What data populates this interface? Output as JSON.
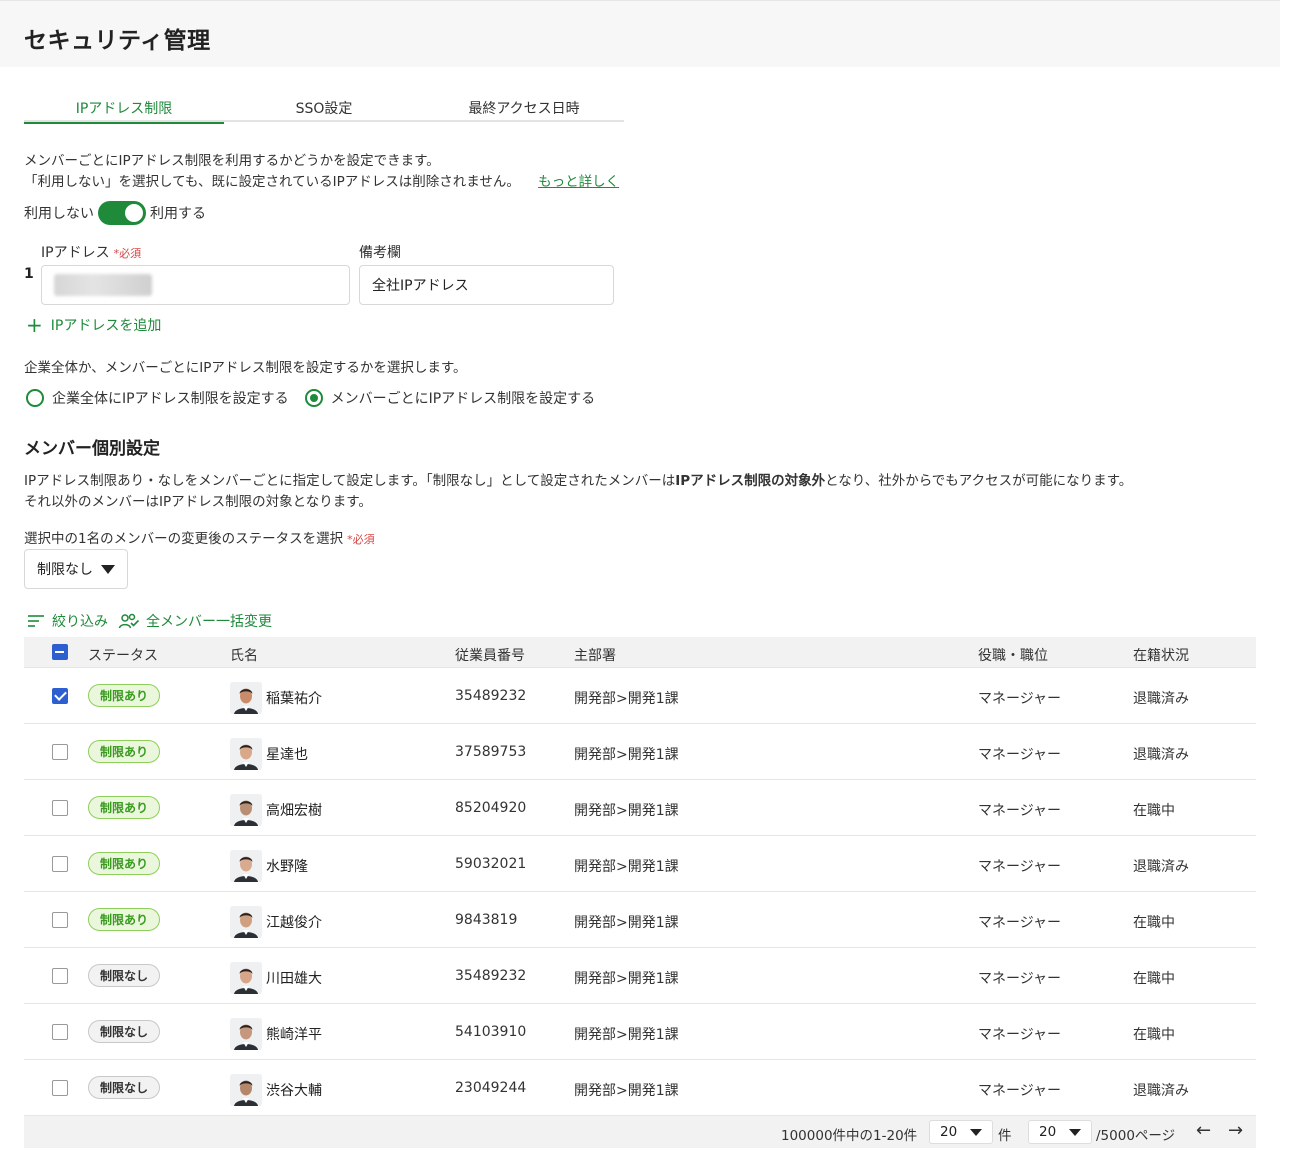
{
  "header": {
    "title": "セキュリティ管理"
  },
  "tabs": [
    {
      "label": "IPアドレス制限",
      "active": true
    },
    {
      "label": "SSO設定",
      "active": false
    },
    {
      "label": "最終アクセス日時",
      "active": false
    }
  ],
  "intro": {
    "line1": "メンバーごとにIPアドレス制限を利用するかどうかを設定できます。",
    "line2": "「利用しない」を選択しても、既に設定されているIPアドレスは削除されません。",
    "more_link": "もっと詳しく"
  },
  "toggle": {
    "off_label": "利用しない",
    "on_label": "利用する",
    "enabled": true
  },
  "ip_form": {
    "ip_label": "IPアドレス",
    "required_mark": "*必須",
    "note_label": "備考欄",
    "row_number": "1",
    "note_value": "全社IPアドレス",
    "add_label": "IPアドレスを追加"
  },
  "scope": {
    "description": "企業全体か、メンバーごとにIPアドレス制限を設定するかを選択します。",
    "options": [
      {
        "label": "企業全体にIPアドレス制限を設定する",
        "checked": false
      },
      {
        "label": "メンバーごとにIPアドレス制限を設定する",
        "checked": true
      }
    ]
  },
  "member_settings": {
    "title": "メンバー個別設定",
    "desc_part1": "IPアドレス制限あり・なしをメンバーごとに指定して設定します。「制限なし」として設定されたメンバーは",
    "desc_bold": "IPアドレス制限の対象外",
    "desc_part2": "となり、社外からでもアクセスが可能になります。",
    "desc_line2": "それ以外のメンバーはIPアドレス制限の対象となります。",
    "status_prompt": "選択中の1名のメンバーの変更後のステータスを選択",
    "required_mark": "*必須",
    "status_select": "制限なし",
    "filter_label": "絞り込み",
    "bulk_label": "全メンバー一括変更"
  },
  "table": {
    "columns": [
      "ステータス",
      "氏名",
      "従業員番号",
      "主部署",
      "役職・職位",
      "在籍状況"
    ],
    "rows": [
      {
        "checked": true,
        "status": "制限あり",
        "status_on": true,
        "name": "稲葉祐介",
        "emp_no": "35489232",
        "dept": "開発部>開発1課",
        "role": "マネージャー",
        "employment": "退職済み",
        "avatar": "#c98c6a"
      },
      {
        "checked": false,
        "status": "制限あり",
        "status_on": true,
        "name": "星達也",
        "emp_no": "37589753",
        "dept": "開発部>開発1課",
        "role": "マネージャー",
        "employment": "退職済み",
        "avatar": "#d9a888"
      },
      {
        "checked": false,
        "status": "制限あり",
        "status_on": true,
        "name": "高畑宏樹",
        "emp_no": "85204920",
        "dept": "開発部>開発1課",
        "role": "マネージャー",
        "employment": "在職中",
        "avatar": "#b98f74"
      },
      {
        "checked": false,
        "status": "制限あり",
        "status_on": true,
        "name": "水野隆",
        "emp_no": "59032021",
        "dept": "開発部>開発1課",
        "role": "マネージャー",
        "employment": "退職済み",
        "avatar": "#d8ab90"
      },
      {
        "checked": false,
        "status": "制限あり",
        "status_on": true,
        "name": "江越俊介",
        "emp_no": "9843819",
        "dept": "開発部>開発1課",
        "role": "マネージャー",
        "employment": "在職中",
        "avatar": "#cfa07f"
      },
      {
        "checked": false,
        "status": "制限なし",
        "status_on": false,
        "name": "川田雄大",
        "emp_no": "35489232",
        "dept": "開発部>開発1課",
        "role": "マネージャー",
        "employment": "在職中",
        "avatar": "#d7a58a"
      },
      {
        "checked": false,
        "status": "制限なし",
        "status_on": false,
        "name": "熊崎洋平",
        "emp_no": "54103910",
        "dept": "開発部>開発1課",
        "role": "マネージャー",
        "employment": "在職中",
        "avatar": "#c5977c"
      },
      {
        "checked": false,
        "status": "制限なし",
        "status_on": false,
        "name": "渋谷大輔",
        "emp_no": "23049244",
        "dept": "開発部>開発1課",
        "role": "マネージャー",
        "employment": "退職済み",
        "avatar": "#b4866a"
      }
    ]
  },
  "pagination": {
    "summary": "100000件中の1-20件",
    "per_page": "20",
    "per_page_unit": "件",
    "page": "20",
    "page_total": "/5000ページ"
  },
  "colors": {
    "accent": "#1e8a3a",
    "checkbox": "#2d5fd0",
    "required": "#d64545"
  }
}
